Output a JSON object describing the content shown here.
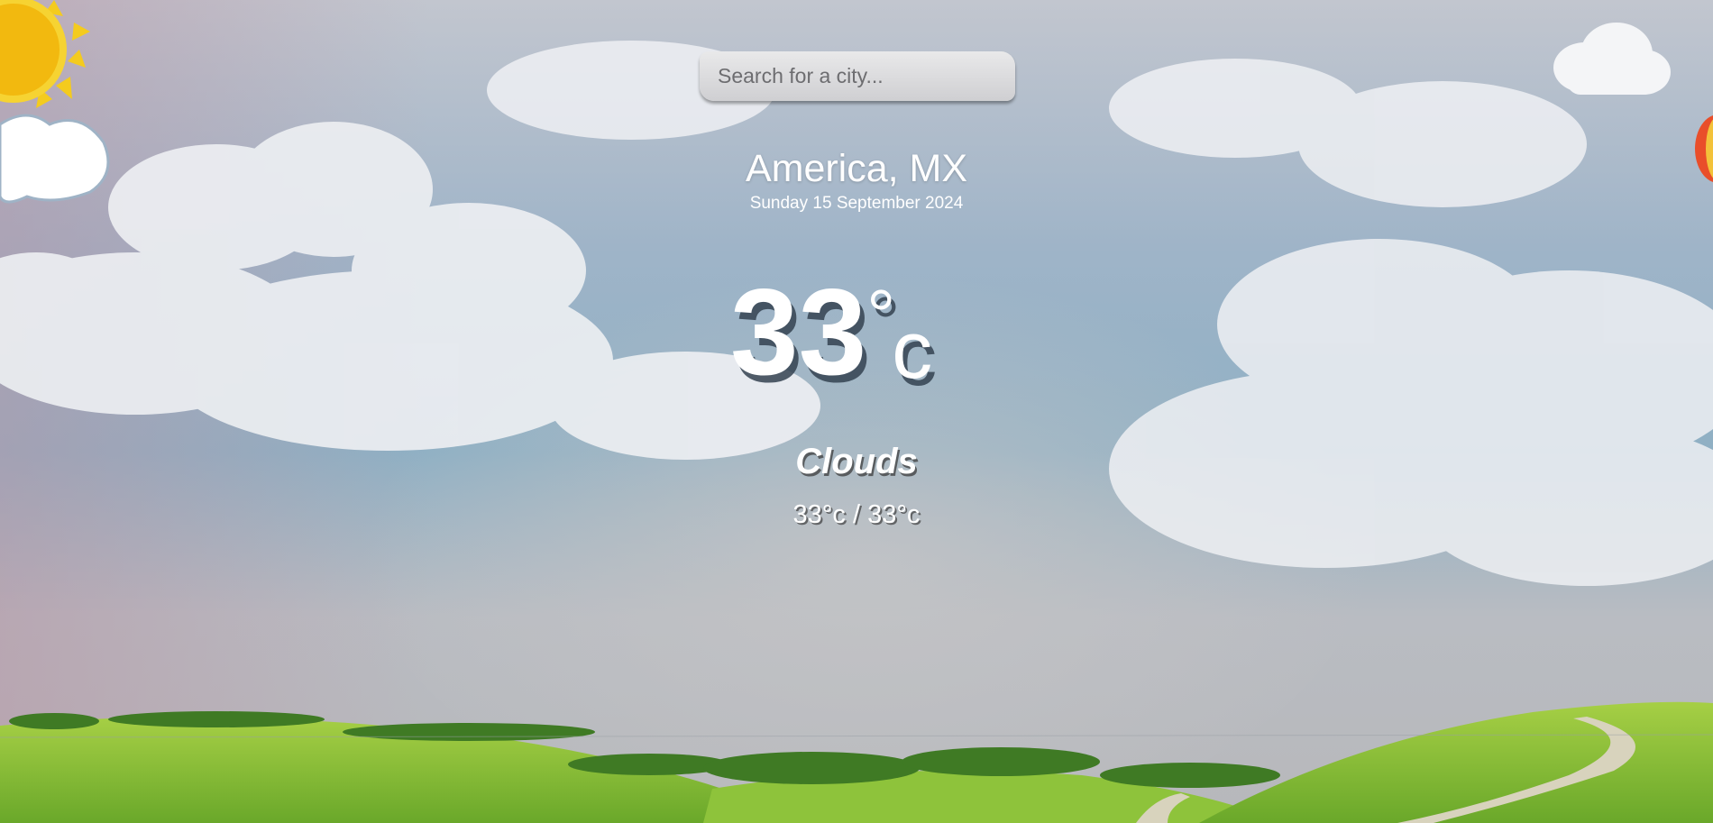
{
  "search": {
    "placeholder": "Search for a city..."
  },
  "weather": {
    "location": "America, MX",
    "date": "Sunday 15 September 2024",
    "temperature": "33",
    "degree_symbol": "°",
    "unit": "c",
    "condition": "Clouds",
    "hi_lo": "33°c / 33°c"
  },
  "colors": {
    "text": "#ffffff",
    "sky": "#8fb0c4",
    "grass": "#8bc23a",
    "sun": "#f2b90f"
  },
  "icons": [
    "sun-icon",
    "cloud-icon",
    "balloon-icon"
  ]
}
